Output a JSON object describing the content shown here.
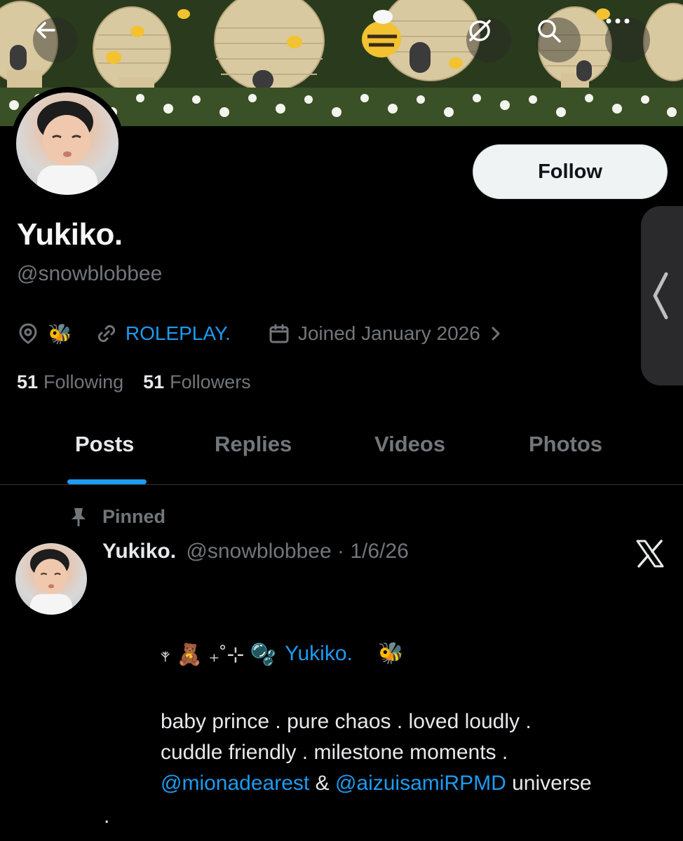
{
  "header": {
    "back_icon": "arrow-left-icon",
    "grok_icon": "grok-icon",
    "search_icon": "search-icon",
    "more_icon": "more-horizontal-icon"
  },
  "profile": {
    "display_name": "Yukiko.",
    "handle": "@snowblobbee",
    "location_emoji": "🐝",
    "link_label": "ROLEPLAY.",
    "joined": "Joined January 2026",
    "following_count": "51",
    "following_label": "Following",
    "followers_count": "51",
    "followers_label": "Followers",
    "follow_label": "Follow"
  },
  "tabs": [
    "Posts",
    "Replies",
    "Videos",
    "Photos"
  ],
  "post": {
    "pinned_label": "Pinned",
    "author_name": "Yukiko.",
    "author_handle": "@snowblobbee",
    "separator": "·",
    "date": "1/6/26",
    "deco_prefix": "𖥧 🧸 ₊˚⊹ 🫧",
    "bio_name": "Yukiko.",
    "bio_emoji": "🐝",
    "line1": "baby prince . pure chaos . loved loudly .",
    "line2": "cuddle friendly . milestone moments .",
    "mention1": "@mionadearest",
    "amp": "&",
    "mention2": "@aizuisamiRPMD",
    "universe": "universe",
    "trailing_dot": "."
  },
  "colors": {
    "accent": "#1d9bf0",
    "background": "#000000",
    "muted": "#71767b",
    "text": "#e7e9ea"
  }
}
